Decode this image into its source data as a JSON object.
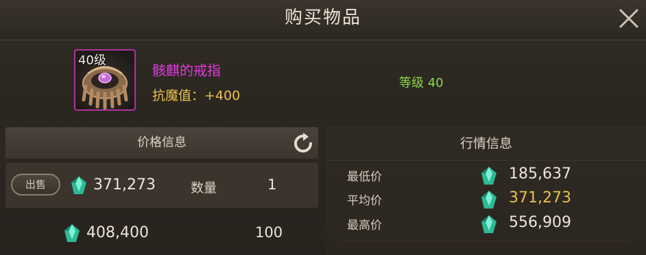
{
  "dialog": {
    "title": "购买物品"
  },
  "item": {
    "level_badge": "40级",
    "name": "骸麒的戒指",
    "stat": "抗魔值：+400",
    "grade": "等级 40",
    "rarity_color": "#b0339c"
  },
  "price_panel": {
    "header": "价格信息",
    "sell_label": "出售",
    "row1": {
      "price": "371,273",
      "qty_label": "数量",
      "qty": "1"
    },
    "row2": {
      "price": "408,400",
      "qty": "100"
    }
  },
  "market_panel": {
    "header": "行情信息",
    "rows": [
      {
        "label": "最低价",
        "value": "185,637",
        "color": "#ebe5dc"
      },
      {
        "label": "平均价",
        "value": "371,273",
        "color": "#e9c24c"
      },
      {
        "label": "最高价",
        "value": "556,909",
        "color": "#ebe5dc"
      }
    ]
  },
  "icons": {
    "close": "close-icon",
    "refresh": "refresh-icon",
    "currency": "green-gem-icon"
  }
}
